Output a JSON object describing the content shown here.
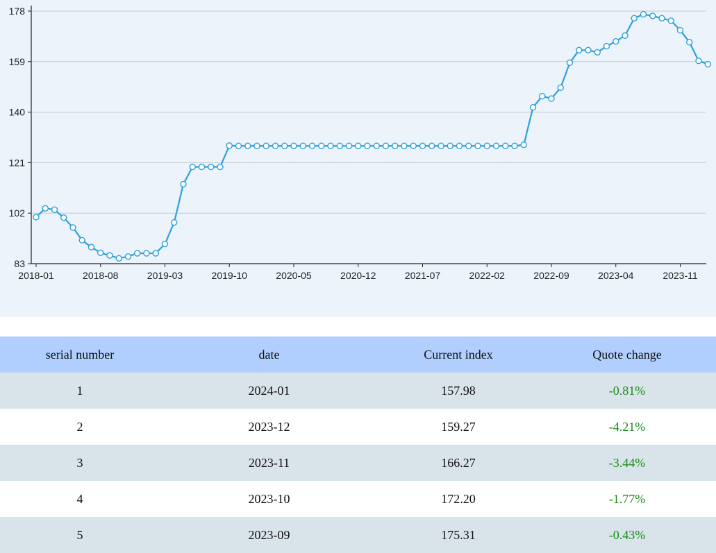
{
  "chart_data": {
    "type": "line",
    "x_tick_labels": [
      "2018-01",
      "2018-08",
      "2019-03",
      "2019-10",
      "2020-05",
      "2020-12",
      "2021-07",
      "2022-02",
      "2022-09",
      "2023-04",
      "2023-11"
    ],
    "y_ticks": [
      83,
      102,
      121,
      140,
      159,
      178
    ],
    "ylim": [
      83,
      178
    ],
    "grid": "horizontal",
    "line_color": "#2ca0dc",
    "x": [
      "2018-01",
      "2018-02",
      "2018-03",
      "2018-04",
      "2018-05",
      "2018-06",
      "2018-07",
      "2018-08",
      "2018-09",
      "2018-10",
      "2018-11",
      "2018-12",
      "2019-01",
      "2019-02",
      "2019-03",
      "2019-04",
      "2019-05",
      "2019-06",
      "2019-07",
      "2019-08",
      "2019-09",
      "2019-10",
      "2019-11",
      "2019-12",
      "2020-01",
      "2020-02",
      "2020-03",
      "2020-04",
      "2020-05",
      "2020-06",
      "2020-07",
      "2020-08",
      "2020-09",
      "2020-10",
      "2020-11",
      "2020-12",
      "2021-01",
      "2021-02",
      "2021-03",
      "2021-04",
      "2021-05",
      "2021-06",
      "2021-07",
      "2021-08",
      "2021-09",
      "2021-10",
      "2021-11",
      "2021-12",
      "2022-01",
      "2022-02",
      "2022-03",
      "2022-04",
      "2022-05",
      "2022-06",
      "2022-07",
      "2022-08",
      "2022-09",
      "2022-10",
      "2022-11",
      "2022-12",
      "2023-01",
      "2023-02",
      "2023-03",
      "2023-04",
      "2023-05",
      "2023-06",
      "2023-07",
      "2023-08",
      "2023-09",
      "2023-10",
      "2023-11",
      "2023-12",
      "2024-01"
    ],
    "values": [
      100.5,
      103.8,
      103.3,
      100.3,
      96.6,
      91.8,
      89.2,
      87.1,
      86.1,
      85.0,
      85.7,
      86.9,
      86.9,
      86.9,
      90.4,
      98.5,
      112.9,
      119.4,
      119.4,
      119.4,
      119.4,
      127.4,
      127.3,
      127.3,
      127.3,
      127.3,
      127.3,
      127.3,
      127.3,
      127.3,
      127.3,
      127.3,
      127.3,
      127.3,
      127.3,
      127.3,
      127.3,
      127.3,
      127.3,
      127.3,
      127.3,
      127.3,
      127.3,
      127.3,
      127.3,
      127.3,
      127.3,
      127.3,
      127.3,
      127.3,
      127.3,
      127.3,
      127.3,
      127.7,
      141.8,
      146.0,
      145.1,
      149.2,
      158.6,
      163.3,
      163.3,
      162.5,
      164.8,
      166.6,
      168.8,
      175.3,
      176.8,
      176.2,
      175.3,
      174.4,
      170.8,
      166.3,
      159.3,
      158.0
    ]
  },
  "table": {
    "headers": [
      "serial number",
      "date",
      "Current index",
      "Quote change"
    ],
    "rows": [
      {
        "serial": "1",
        "date": "2024-01",
        "index": "157.98",
        "change": "-0.81%"
      },
      {
        "serial": "2",
        "date": "2023-12",
        "index": "159.27",
        "change": "-4.21%"
      },
      {
        "serial": "3",
        "date": "2023-11",
        "index": "166.27",
        "change": "-3.44%"
      },
      {
        "serial": "4",
        "date": "2023-10",
        "index": "172.20",
        "change": "-1.77%"
      },
      {
        "serial": "5",
        "date": "2023-09",
        "index": "175.31",
        "change": "-0.43%"
      }
    ]
  }
}
